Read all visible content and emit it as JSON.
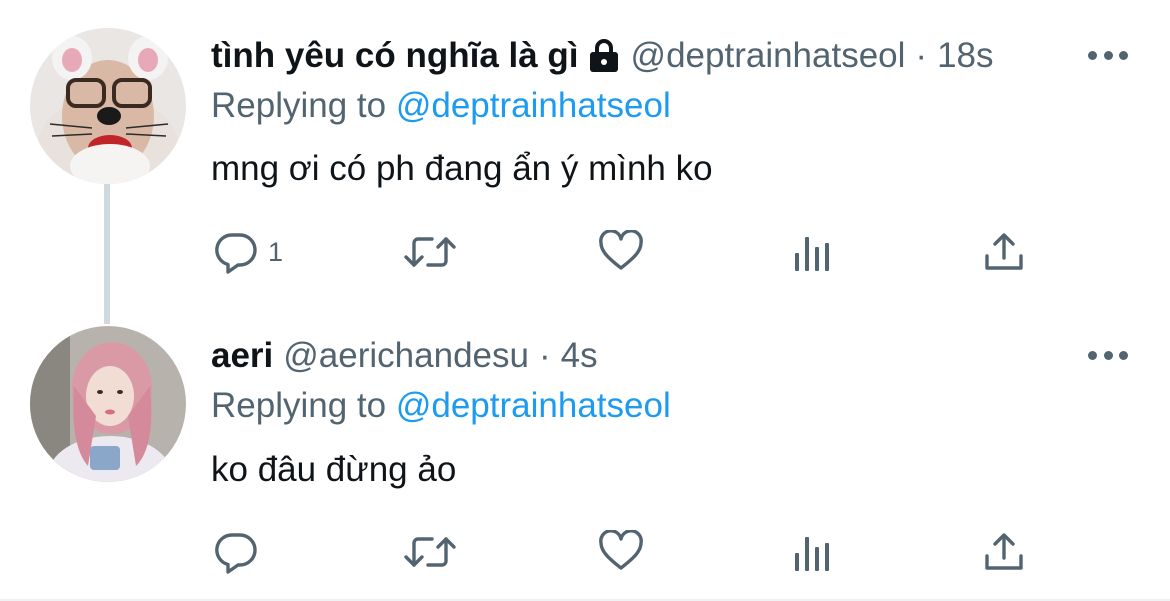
{
  "tweets": [
    {
      "display_name": "tình yêu có nghĩa là gì",
      "handle": "@deptrainhatseol",
      "separator": "·",
      "time": "18s",
      "replying_prefix": "Replying to",
      "replying_handle": "@deptrainhatseol",
      "text": "mng ơi có ph đang ẩn ý mình ko",
      "reply_count": "1",
      "protected": true
    },
    {
      "display_name": "aeri",
      "handle": "@aerichandesu",
      "separator": "·",
      "time": "4s",
      "replying_prefix": "Replying to",
      "replying_handle": "@deptrainhatseol",
      "text": "ko đâu đừng ảo",
      "reply_count": ""
    }
  ],
  "colors": {
    "text": "#0f1419",
    "muted": "#536471",
    "link": "#1d9bf0",
    "thread_line": "#cfd9de"
  },
  "icons": [
    "reply-icon",
    "retweet-icon",
    "like-icon",
    "analytics-icon",
    "share-icon",
    "lock-icon",
    "more-icon"
  ]
}
